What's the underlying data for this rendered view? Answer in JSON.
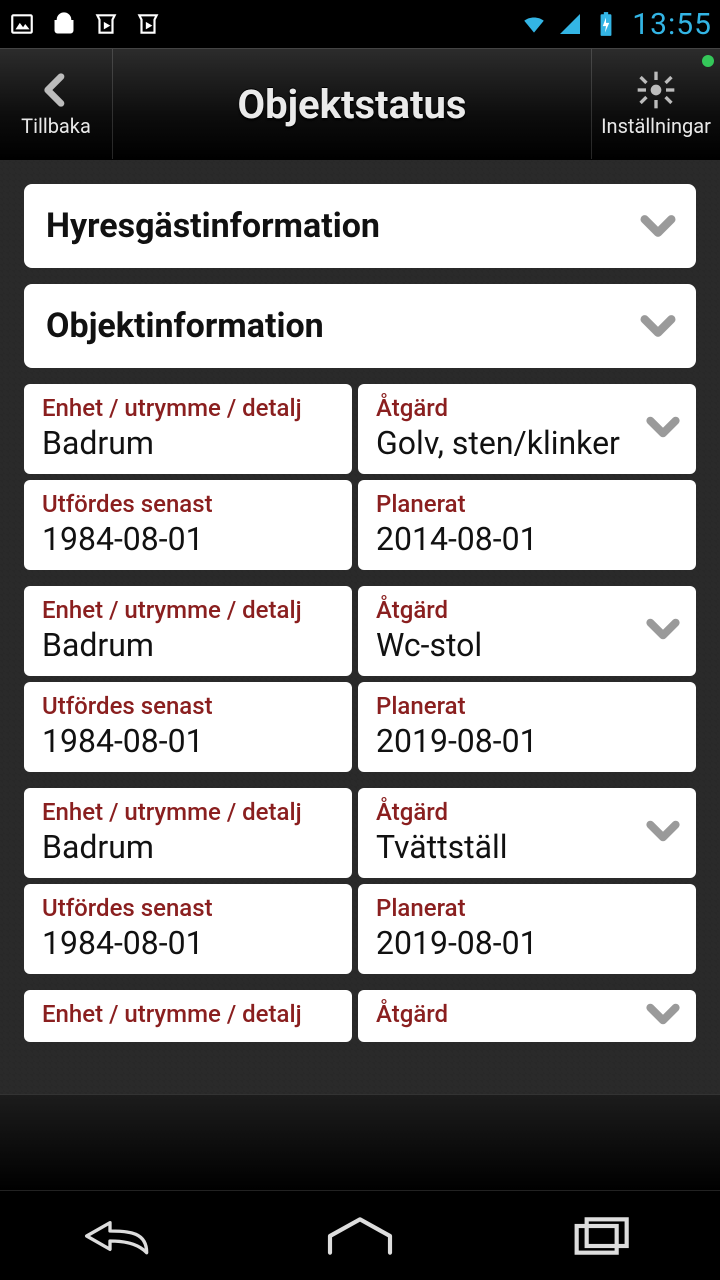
{
  "status": {
    "clock": "13:55"
  },
  "toolbar": {
    "back_label": "Tillbaka",
    "title": "Objektstatus",
    "settings_label": "Inställningar"
  },
  "panels": {
    "tenant_info": "Hyresgästinformation",
    "object_info": "Objektinformation"
  },
  "labels": {
    "unit": "Enhet / utrymme / detalj",
    "action": "Åtgärd",
    "last_done": "Utfördes senast",
    "planned": "Planerat"
  },
  "records": [
    {
      "unit": "Badrum",
      "action": "Golv, sten/klinker",
      "last_done": "1984-08-01",
      "planned": "2014-08-01"
    },
    {
      "unit": "Badrum",
      "action": "Wc-stol",
      "last_done": "1984-08-01",
      "planned": "2019-08-01"
    },
    {
      "unit": "Badrum",
      "action": "Tvättställ",
      "last_done": "1984-08-01",
      "planned": "2019-08-01"
    },
    {
      "unit": "",
      "action": "",
      "last_done": "",
      "planned": ""
    }
  ]
}
